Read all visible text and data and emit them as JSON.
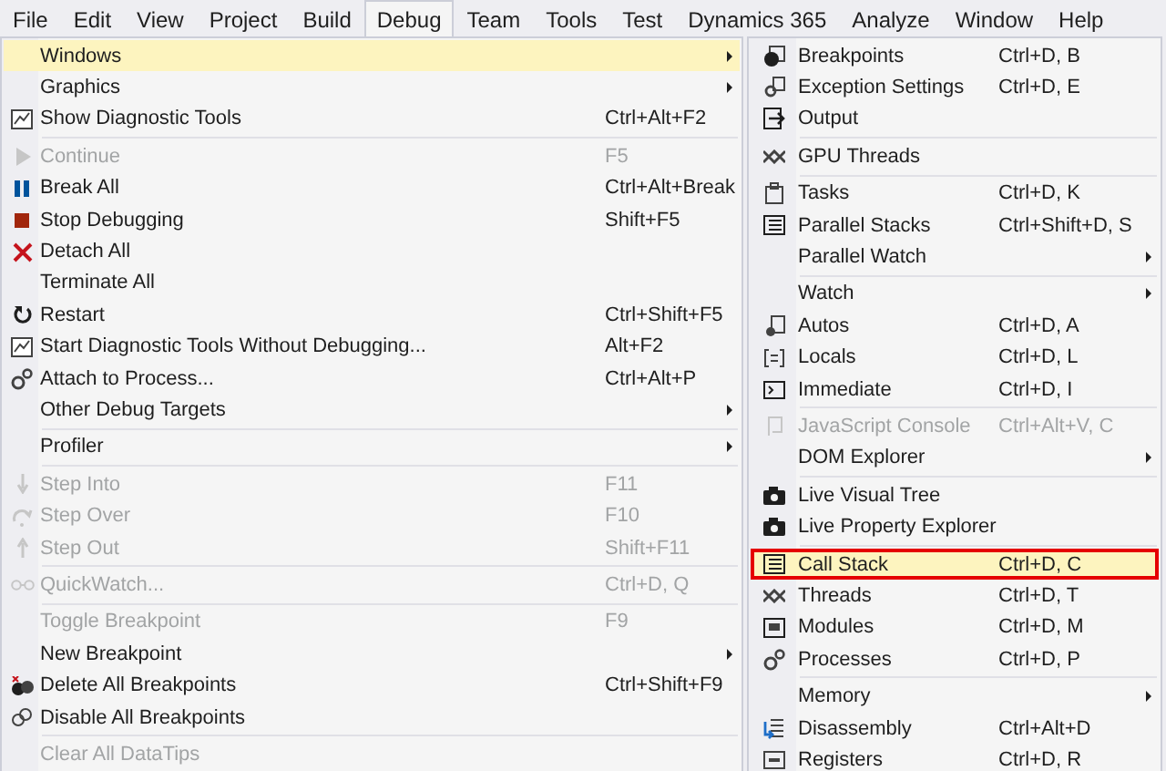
{
  "menubar": [
    {
      "label": "File",
      "selected": false
    },
    {
      "label": "Edit",
      "selected": false
    },
    {
      "label": "View",
      "selected": false
    },
    {
      "label": "Project",
      "selected": false
    },
    {
      "label": "Build",
      "selected": false
    },
    {
      "label": "Debug",
      "selected": true
    },
    {
      "label": "Team",
      "selected": false
    },
    {
      "label": "Tools",
      "selected": false
    },
    {
      "label": "Test",
      "selected": false
    },
    {
      "label": "Dynamics 365",
      "selected": false
    },
    {
      "label": "Analyze",
      "selected": false
    },
    {
      "label": "Window",
      "selected": false
    },
    {
      "label": "Help",
      "selected": false
    }
  ],
  "debug_menu": {
    "items": [
      {
        "kind": "item",
        "label": "Windows",
        "submenu": true,
        "disabled": false,
        "selected": true
      },
      {
        "kind": "item",
        "label": "Graphics",
        "submenu": true,
        "disabled": false,
        "selected": false
      },
      {
        "kind": "item",
        "label": "Show Diagnostic Tools",
        "shortcut": "Ctrl+Alt+F2",
        "submenu": false,
        "disabled": false,
        "selected": false
      },
      {
        "kind": "separator"
      },
      {
        "kind": "item",
        "label": "Continue",
        "shortcut": "F5",
        "submenu": false,
        "disabled": true,
        "selected": false
      },
      {
        "kind": "item",
        "label": "Break All",
        "shortcut": "Ctrl+Alt+Break",
        "submenu": false,
        "disabled": false,
        "selected": false
      },
      {
        "kind": "item",
        "label": "Stop Debugging",
        "shortcut": "Shift+F5",
        "submenu": false,
        "disabled": false,
        "selected": false
      },
      {
        "kind": "item",
        "label": "Detach All",
        "submenu": false,
        "disabled": false,
        "selected": false
      },
      {
        "kind": "item",
        "label": "Terminate All",
        "submenu": false,
        "disabled": false,
        "selected": false
      },
      {
        "kind": "item",
        "label": "Restart",
        "shortcut": "Ctrl+Shift+F5",
        "submenu": false,
        "disabled": false,
        "selected": false
      },
      {
        "kind": "item",
        "label": "Start Diagnostic Tools Without Debugging...",
        "shortcut": "Alt+F2",
        "submenu": false,
        "disabled": false,
        "selected": false
      },
      {
        "kind": "item",
        "label": "Attach to Process...",
        "shortcut": "Ctrl+Alt+P",
        "submenu": false,
        "disabled": false,
        "selected": false
      },
      {
        "kind": "item",
        "label": "Other Debug Targets",
        "submenu": true,
        "disabled": false,
        "selected": false
      },
      {
        "kind": "separator"
      },
      {
        "kind": "item",
        "label": "Profiler",
        "submenu": true,
        "disabled": false,
        "selected": false
      },
      {
        "kind": "separator"
      },
      {
        "kind": "item",
        "label": "Step Into",
        "shortcut": "F11",
        "submenu": false,
        "disabled": true,
        "selected": false
      },
      {
        "kind": "item",
        "label": "Step Over",
        "shortcut": "F10",
        "submenu": false,
        "disabled": true,
        "selected": false
      },
      {
        "kind": "item",
        "label": "Step Out",
        "shortcut": "Shift+F11",
        "submenu": false,
        "disabled": true,
        "selected": false
      },
      {
        "kind": "separator"
      },
      {
        "kind": "item",
        "label": "QuickWatch...",
        "shortcut": "Ctrl+D, Q",
        "submenu": false,
        "disabled": true,
        "selected": false
      },
      {
        "kind": "separator"
      },
      {
        "kind": "item",
        "label": "Toggle Breakpoint",
        "shortcut": "F9",
        "submenu": false,
        "disabled": true,
        "selected": false
      },
      {
        "kind": "item",
        "label": "New Breakpoint",
        "submenu": true,
        "disabled": false,
        "selected": false
      },
      {
        "kind": "item",
        "label": "Delete All Breakpoints",
        "shortcut": "Ctrl+Shift+F9",
        "submenu": false,
        "disabled": false,
        "selected": false
      },
      {
        "kind": "item",
        "label": "Disable All Breakpoints",
        "submenu": false,
        "disabled": false,
        "selected": false
      },
      {
        "kind": "separator"
      },
      {
        "kind": "item",
        "label": "Clear All DataTips",
        "submenu": false,
        "disabled": true,
        "selected": false
      }
    ]
  },
  "windows_submenu": {
    "items": [
      {
        "kind": "item",
        "label": "Breakpoints",
        "shortcut": "Ctrl+D, B",
        "submenu": false,
        "disabled": false,
        "selected": false,
        "outlined": false
      },
      {
        "kind": "item",
        "label": "Exception Settings",
        "shortcut": "Ctrl+D, E",
        "submenu": false,
        "disabled": false,
        "selected": false,
        "outlined": false
      },
      {
        "kind": "item",
        "label": "Output",
        "submenu": false,
        "disabled": false,
        "selected": false,
        "outlined": false
      },
      {
        "kind": "separator"
      },
      {
        "kind": "item",
        "label": "GPU Threads",
        "submenu": false,
        "disabled": false,
        "selected": false,
        "outlined": false
      },
      {
        "kind": "separator"
      },
      {
        "kind": "item",
        "label": "Tasks",
        "shortcut": "Ctrl+D, K",
        "submenu": false,
        "disabled": false,
        "selected": false,
        "outlined": false
      },
      {
        "kind": "item",
        "label": "Parallel Stacks",
        "shortcut": "Ctrl+Shift+D, S",
        "submenu": false,
        "disabled": false,
        "selected": false,
        "outlined": false
      },
      {
        "kind": "item",
        "label": "Parallel Watch",
        "submenu": true,
        "disabled": false,
        "selected": false,
        "outlined": false
      },
      {
        "kind": "separator"
      },
      {
        "kind": "item",
        "label": "Watch",
        "submenu": true,
        "disabled": false,
        "selected": false,
        "outlined": false
      },
      {
        "kind": "item",
        "label": "Autos",
        "shortcut": "Ctrl+D, A",
        "submenu": false,
        "disabled": false,
        "selected": false,
        "outlined": false
      },
      {
        "kind": "item",
        "label": "Locals",
        "shortcut": "Ctrl+D, L",
        "submenu": false,
        "disabled": false,
        "selected": false,
        "outlined": false
      },
      {
        "kind": "item",
        "label": "Immediate",
        "shortcut": "Ctrl+D, I",
        "submenu": false,
        "disabled": false,
        "selected": false,
        "outlined": false
      },
      {
        "kind": "separator"
      },
      {
        "kind": "item",
        "label": "JavaScript Console",
        "shortcut": "Ctrl+Alt+V, C",
        "submenu": false,
        "disabled": true,
        "selected": false,
        "outlined": false
      },
      {
        "kind": "item",
        "label": "DOM Explorer",
        "submenu": true,
        "disabled": false,
        "selected": false,
        "outlined": false
      },
      {
        "kind": "separator"
      },
      {
        "kind": "item",
        "label": "Live Visual Tree",
        "submenu": false,
        "disabled": false,
        "selected": false,
        "outlined": false
      },
      {
        "kind": "item",
        "label": "Live Property Explorer",
        "submenu": false,
        "disabled": false,
        "selected": false,
        "outlined": false
      },
      {
        "kind": "separator"
      },
      {
        "kind": "item",
        "label": "Call Stack",
        "shortcut": "Ctrl+D, C",
        "submenu": false,
        "disabled": false,
        "selected": true,
        "outlined": true
      },
      {
        "kind": "item",
        "label": "Threads",
        "shortcut": "Ctrl+D, T",
        "submenu": false,
        "disabled": false,
        "selected": false,
        "outlined": false
      },
      {
        "kind": "item",
        "label": "Modules",
        "shortcut": "Ctrl+D, M",
        "submenu": false,
        "disabled": false,
        "selected": false,
        "outlined": false
      },
      {
        "kind": "item",
        "label": "Processes",
        "shortcut": "Ctrl+D, P",
        "submenu": false,
        "disabled": false,
        "selected": false,
        "outlined": false
      },
      {
        "kind": "separator"
      },
      {
        "kind": "item",
        "label": "Memory",
        "submenu": true,
        "disabled": false,
        "selected": false,
        "outlined": false
      },
      {
        "kind": "item",
        "label": "Disassembly",
        "shortcut": "Ctrl+Alt+D",
        "submenu": false,
        "disabled": false,
        "selected": false,
        "outlined": false
      },
      {
        "kind": "item",
        "label": "Registers",
        "shortcut": "Ctrl+D, R",
        "submenu": false,
        "disabled": false,
        "selected": false,
        "outlined": false
      }
    ]
  }
}
